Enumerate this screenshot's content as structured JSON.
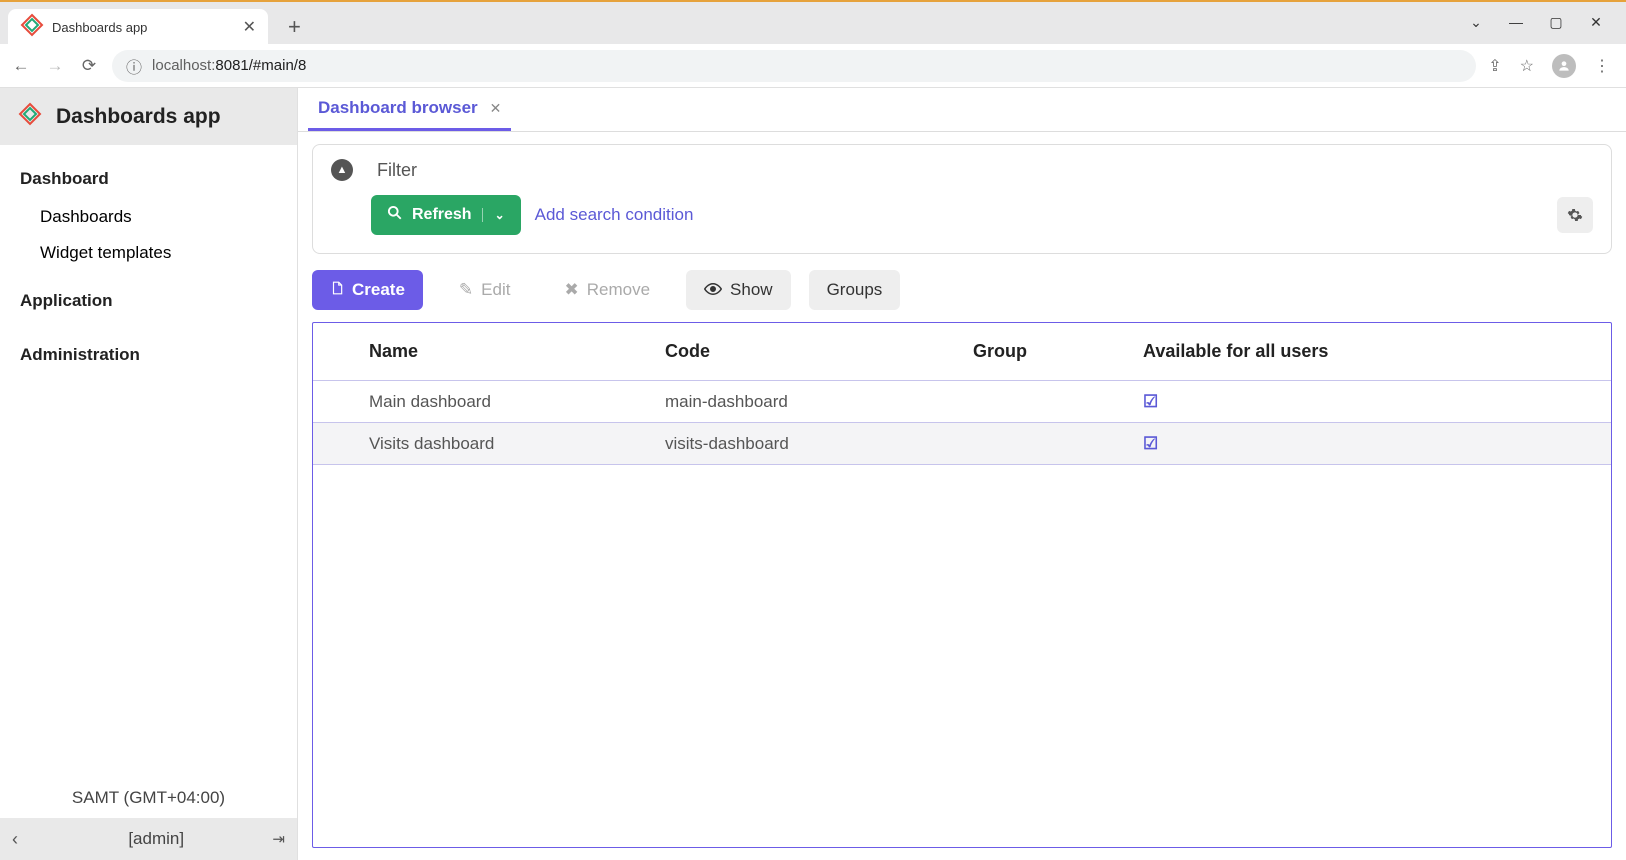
{
  "browser": {
    "tab_title": "Dashboards app",
    "url_host_muted": "localhost:",
    "url_rest": "8081/#main/8"
  },
  "win_controls": {
    "chevron": "⌄",
    "min": "—",
    "max": "▢",
    "close": "✕"
  },
  "sidebar": {
    "app_title": "Dashboards app",
    "items": [
      {
        "label": "Dashboard"
      },
      {
        "label": "Dashboards"
      },
      {
        "label": "Widget templates"
      },
      {
        "label": "Application"
      },
      {
        "label": "Administration"
      }
    ],
    "timezone": "SAMT (GMT+04:00)",
    "user": "[admin]"
  },
  "main_tab": {
    "label": "Dashboard browser"
  },
  "filter": {
    "title": "Filter",
    "refresh": "Refresh",
    "add_cond": "Add search condition"
  },
  "toolbar": {
    "create": "Create",
    "edit": "Edit",
    "remove": "Remove",
    "show": "Show",
    "groups": "Groups"
  },
  "table": {
    "headers": {
      "name": "Name",
      "code": "Code",
      "group": "Group",
      "avail": "Available for all users"
    },
    "rows": [
      {
        "name": "Main dashboard",
        "code": "main-dashboard",
        "group": "",
        "avail": true
      },
      {
        "name": "Visits dashboard",
        "code": "visits-dashboard",
        "group": "",
        "avail": true
      }
    ]
  }
}
